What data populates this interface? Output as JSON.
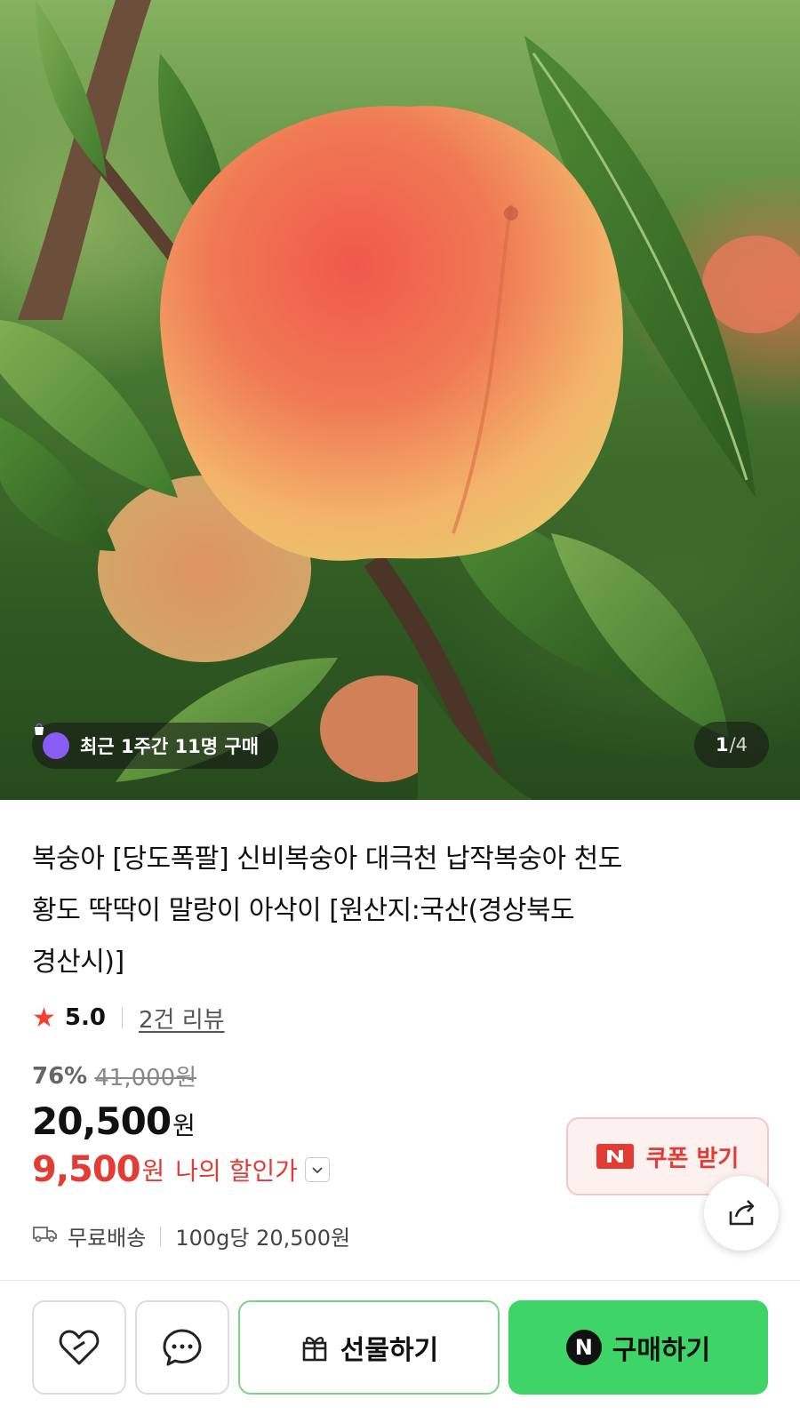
{
  "hero": {
    "buyers_badge": "최근 1주간 11명 구매",
    "image_counter": {
      "current": "1",
      "total": "/4"
    }
  },
  "product": {
    "title_lines": [
      "복숭아 [당도폭팔] 신비복숭아 대극천 납작복숭아 천도",
      "황도 딱딱이 말랑이 아삭이 [원산지:국산(경상북도",
      "경산시)]"
    ],
    "rating": {
      "score": "5.0",
      "reviews": "2건 리뷰"
    }
  },
  "pricing": {
    "discount_pct": "76%",
    "original_price": "41,000원",
    "sale_price": "20,500",
    "currency": "원",
    "my_price": "9,500",
    "my_price_label": "나의 할인가"
  },
  "coupon": {
    "label": "쿠폰 받기",
    "badge": "N"
  },
  "shipping": {
    "label": "무료배송",
    "unit_price": "100g당 20,500원"
  },
  "actions": {
    "gift_label": "선물하기",
    "buy_label": "구매하기",
    "buy_logo": "N"
  },
  "colors": {
    "accent_red": "#e43b35",
    "naver_green": "#3fd467",
    "gift_border": "#7fd18a",
    "star": "#f4412f"
  },
  "icons": [
    "shopping-bag-icon",
    "star-icon",
    "chevron-down-icon",
    "share-icon",
    "truck-icon",
    "heart-icon",
    "chat-bubble-icon",
    "gift-icon",
    "naver-n-icon"
  ]
}
